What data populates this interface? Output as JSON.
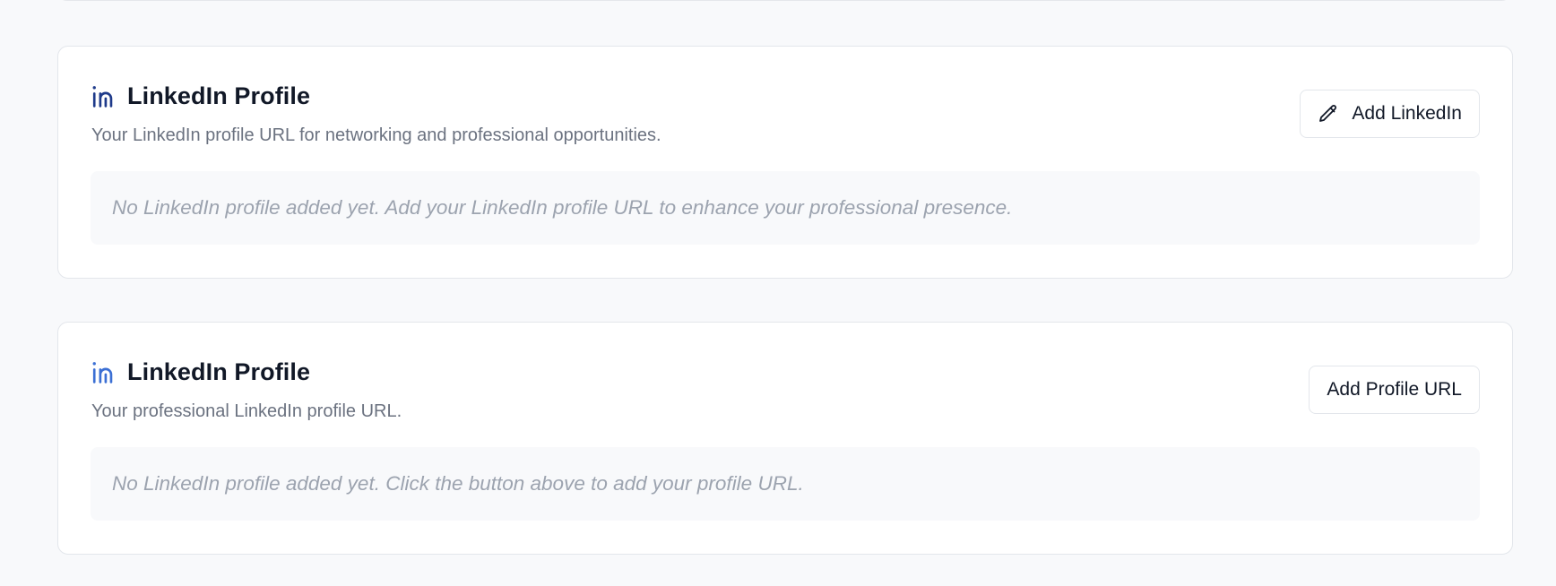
{
  "cards": [
    {
      "title": "LinkedIn Profile",
      "description": "Your LinkedIn profile URL for networking and professional opportunities.",
      "button_label": "Add LinkedIn",
      "button_icon": "pencil-icon",
      "empty_message": "No LinkedIn profile added yet. Add your LinkedIn profile URL to enhance your professional presence.",
      "icon": "linkedin-icon",
      "icon_color": "#1e3a8a"
    },
    {
      "title": "LinkedIn Profile",
      "description": "Your professional LinkedIn profile URL.",
      "button_label": "Add Profile URL",
      "empty_message": "No LinkedIn profile added yet. Click the button above to add your profile URL.",
      "icon": "linkedin-icon",
      "icon_color": "#3b6fd4"
    }
  ]
}
